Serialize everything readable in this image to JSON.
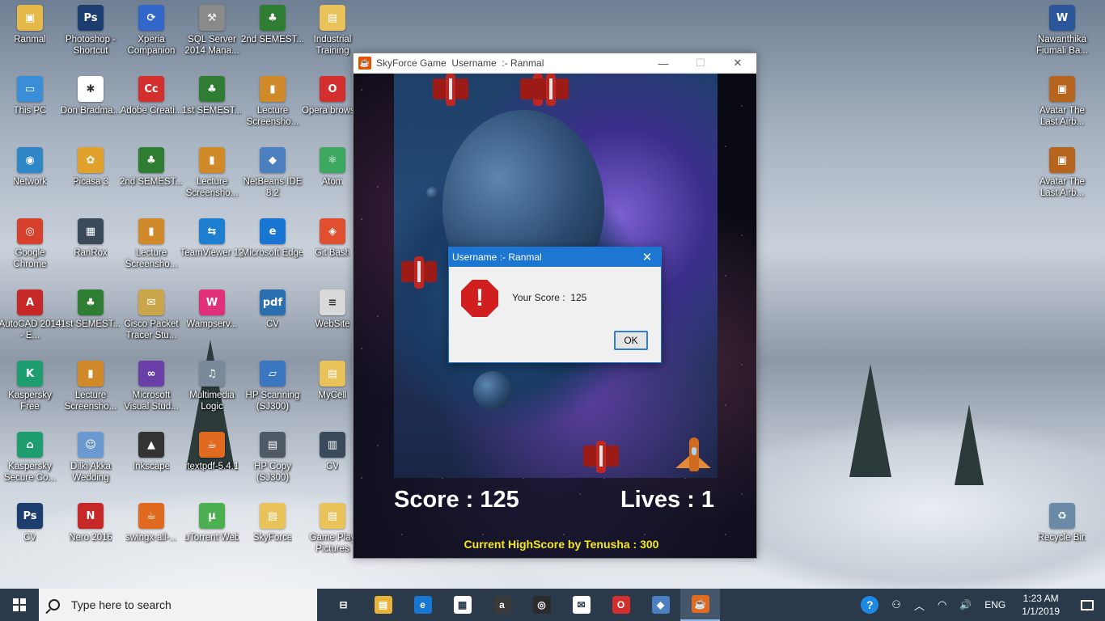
{
  "desktop_icons": [
    {
      "label": "Ranmal",
      "icon": "user-folder-icon",
      "glyph": "▣",
      "color": "#e5b84a"
    },
    {
      "label": "Photoshop - Shortcut",
      "icon": "photoshop-icon",
      "glyph": "Ps",
      "color": "#1b3e6e"
    },
    {
      "label": "Xperia Companion",
      "icon": "xperia-icon",
      "glyph": "⟳",
      "color": "#3266c8"
    },
    {
      "label": "SQL Server 2014 Mana...",
      "icon": "sql-server-icon",
      "glyph": "⚒",
      "color": "#8a8a8a"
    },
    {
      "label": "2nd SEMEST...",
      "icon": "tree-icon",
      "glyph": "♣",
      "color": "#2e7d32"
    },
    {
      "label": "Industrial Training",
      "icon": "folder-icon",
      "glyph": "▤",
      "color": "#e9c35a"
    },
    {
      "label": "This PC",
      "icon": "computer-icon",
      "glyph": "▭",
      "color": "#3a8ed8"
    },
    {
      "label": "Don Bradma...",
      "icon": "cricket-icon",
      "glyph": "✱",
      "color": "#ffffff"
    },
    {
      "label": "Adobe Creati...",
      "icon": "adobe-cc-icon",
      "glyph": "Cc",
      "color": "#d32f2f"
    },
    {
      "label": "1st SEMEST...",
      "icon": "tree-icon",
      "glyph": "♣",
      "color": "#2e7d32"
    },
    {
      "label": "Lecture Screensho...",
      "icon": "phone-folder-icon",
      "glyph": "▮",
      "color": "#d08a2a"
    },
    {
      "label": "Opera browser",
      "icon": "opera-icon",
      "glyph": "O",
      "color": "#d32f2f"
    },
    {
      "label": "Network",
      "icon": "network-icon",
      "glyph": "◉",
      "color": "#2f87c8"
    },
    {
      "label": "Picasa 3",
      "icon": "picasa-icon",
      "glyph": "✿",
      "color": "#e0a22a"
    },
    {
      "label": "2nd SEMEST...",
      "icon": "tree-icon",
      "glyph": "♣",
      "color": "#2e7d32"
    },
    {
      "label": "Lecture Screensho...",
      "icon": "phone-folder-icon",
      "glyph": "▮",
      "color": "#d08a2a"
    },
    {
      "label": "NetBeans IDE 8.2",
      "icon": "netbeans-icon",
      "glyph": "◆",
      "color": "#4c7fbf"
    },
    {
      "label": "Atom",
      "icon": "atom-icon",
      "glyph": "⚛",
      "color": "#3ca860"
    },
    {
      "label": "Google Chrome",
      "icon": "chrome-icon",
      "glyph": "◎",
      "color": "#d8402e"
    },
    {
      "label": "RanRox",
      "icon": "video-icon",
      "glyph": "▦",
      "color": "#3b4a5a"
    },
    {
      "label": "Lecture Screensho...",
      "icon": "phone-folder-icon",
      "glyph": "▮",
      "color": "#d08a2a"
    },
    {
      "label": "TeamViewer 12",
      "icon": "teamviewer-icon",
      "glyph": "⇆",
      "color": "#1e7fd0"
    },
    {
      "label": "Microsoft Edge",
      "icon": "edge-icon",
      "glyph": "e",
      "color": "#1976d2"
    },
    {
      "label": "Git Bash",
      "icon": "git-icon",
      "glyph": "◈",
      "color": "#e05030"
    },
    {
      "label": "AutoCAD 2014 - E...",
      "icon": "autocad-icon",
      "glyph": "A",
      "color": "#c62828"
    },
    {
      "label": "1st SEMEST...",
      "icon": "tree-icon",
      "glyph": "♣",
      "color": "#2e7d32"
    },
    {
      "label": "Cisco Packet Tracer Stu...",
      "icon": "cisco-icon",
      "glyph": "✉",
      "color": "#c9a64a"
    },
    {
      "label": "Wampserv...",
      "icon": "wamp-icon",
      "glyph": "W",
      "color": "#e0307a"
    },
    {
      "label": "CV",
      "icon": "pdf-icon",
      "glyph": "pdf",
      "color": "#2a6fb0"
    },
    {
      "label": "WebSite",
      "icon": "document-icon",
      "glyph": "≡",
      "color": "#d9d9d9"
    },
    {
      "label": "Kaspersky Free",
      "icon": "kaspersky-icon",
      "glyph": "K",
      "color": "#1e9e6e"
    },
    {
      "label": "Lecture Screensho...",
      "icon": "phone-folder-icon",
      "glyph": "▮",
      "color": "#d08a2a"
    },
    {
      "label": "Microsoft Visual Stud...",
      "icon": "visual-studio-icon",
      "glyph": "∞",
      "color": "#6a3fa8"
    },
    {
      "label": "Multimedia Logic",
      "icon": "multimedia-icon",
      "glyph": "♫",
      "color": "#7a8a9a"
    },
    {
      "label": "HP Scanning (SJ300)",
      "icon": "scanner-icon",
      "glyph": "▱",
      "color": "#3b77c0"
    },
    {
      "label": "MyCell",
      "icon": "folder-icon",
      "glyph": "▤",
      "color": "#e9c35a"
    },
    {
      "label": "Kaspersky Secure Co...",
      "icon": "kaspersky-secure-icon",
      "glyph": "⌂",
      "color": "#1e9e6e"
    },
    {
      "label": "Dilki Akka Wedding",
      "icon": "people-icon",
      "glyph": "☺",
      "color": "#6a9ad0"
    },
    {
      "label": "Inkscape",
      "icon": "inkscape-icon",
      "glyph": "▲",
      "color": "#333333"
    },
    {
      "label": "itextpdf-5.4.1",
      "icon": "java-icon",
      "glyph": "☕",
      "color": "#e06a20"
    },
    {
      "label": "HP Copy (SJ300)",
      "icon": "copier-icon",
      "glyph": "▤",
      "color": "#505a66"
    },
    {
      "label": "CV",
      "icon": "word-doc-icon",
      "glyph": "▥",
      "color": "#3a4a5a"
    },
    {
      "label": "CV",
      "icon": "photoshop-file-icon",
      "glyph": "Ps",
      "color": "#1b3e6e"
    },
    {
      "label": "Nero 2016",
      "icon": "nero-icon",
      "glyph": "N",
      "color": "#c62828"
    },
    {
      "label": "swingx-all-...",
      "icon": "java-icon",
      "glyph": "☕",
      "color": "#e06a20"
    },
    {
      "label": "uTorrent Web",
      "icon": "utorrent-icon",
      "glyph": "µ",
      "color": "#4caf50"
    },
    {
      "label": "SkyForce",
      "icon": "folder-icon",
      "glyph": "▤",
      "color": "#e9c35a"
    },
    {
      "label": "Game Play Pictures",
      "icon": "folder-icon",
      "glyph": "▤",
      "color": "#e9c35a"
    },
    {
      "label": "Nawanthika Fiumali Ba...",
      "icon": "word-icon",
      "glyph": "W",
      "color": "#2b579a"
    },
    {
      "label": "Avatar The Last Airb...",
      "icon": "archive-icon",
      "glyph": "▣",
      "color": "#b5651d"
    },
    {
      "label": "Avatar The Last Airb...",
      "icon": "archive-icon",
      "glyph": "▣",
      "color": "#b5651d"
    },
    {
      "label": "Recycle Bin",
      "icon": "recycle-bin-icon",
      "glyph": "♻",
      "color": "#6a8aa8"
    }
  ],
  "game_window": {
    "title": "SkyForce Game  Username  :- Ranmal",
    "minimize": "—",
    "maximize": "☐",
    "close": "✕",
    "score_text": "Score : 125",
    "lives_text": "Lives : 1",
    "highscore_text": "Current HighScore by Tenusha : 300",
    "score": 125,
    "lives": 1,
    "highscore": 300
  },
  "dialog": {
    "title": "Username :- Ranmal",
    "close": "✕",
    "icon_glyph": "!",
    "message": "Your Score :  125",
    "ok_label": "OK"
  },
  "taskbar": {
    "search_placeholder": "Type here to search",
    "apps": [
      {
        "name": "task-view",
        "glyph": "⊟",
        "color": "#2a3a4a"
      },
      {
        "name": "file-explorer",
        "glyph": "▤",
        "color": "#e9b33a"
      },
      {
        "name": "edge",
        "glyph": "e",
        "color": "#1976d2"
      },
      {
        "name": "store",
        "glyph": "▦",
        "color": "#ffffff"
      },
      {
        "name": "amazon",
        "glyph": "a",
        "color": "#3a3a3a"
      },
      {
        "name": "tripadvisor",
        "glyph": "◎",
        "color": "#2b2b2b"
      },
      {
        "name": "mail",
        "glyph": "✉",
        "color": "#ffffff"
      },
      {
        "name": "opera",
        "glyph": "O",
        "color": "#d32f2f"
      },
      {
        "name": "netbeans",
        "glyph": "◆",
        "color": "#4c7fbf"
      },
      {
        "name": "java",
        "glyph": "☕",
        "color": "#e06a20"
      }
    ],
    "tray_help": "?",
    "tray_people": "⚇",
    "tray_chevron": "︿",
    "tray_network": "◠",
    "tray_volume": "🔊",
    "language": "ENG",
    "time": "1:23 AM",
    "date": "1/1/2019"
  }
}
